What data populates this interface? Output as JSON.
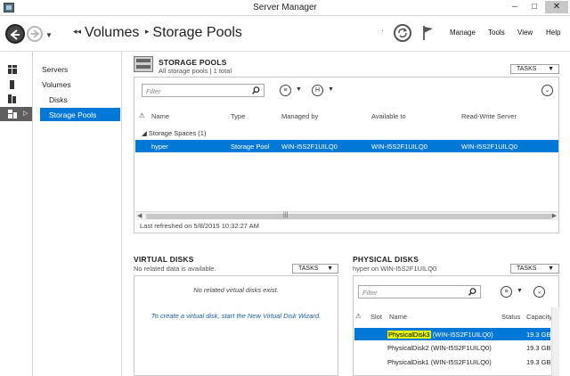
{
  "window": {
    "title": "Server Manager",
    "min": "–",
    "max": "□",
    "close": "✕"
  },
  "header": {
    "breadcrumb": [
      "Volumes",
      "Storage Pools"
    ],
    "menu": {
      "manage": "Manage",
      "tools": "Tools",
      "view": "View",
      "help": "Help"
    }
  },
  "nav": {
    "servers": "Servers",
    "volumes": "Volumes",
    "disks": "Disks",
    "storage_pools": "Storage Pools"
  },
  "storage_pools": {
    "title": "STORAGE POOLS",
    "subtitle": "All storage pools | 1 total",
    "tasks": "TASKS",
    "filter_placeholder": "Filter",
    "columns": {
      "name": "Name",
      "type": "Type",
      "managed_by": "Managed by",
      "available_to": "Available to",
      "rw_server": "Read-Write Server"
    },
    "group": "Storage Spaces (1)",
    "rows": [
      {
        "name": "hyper",
        "type": "Storage Pool",
        "managed_by": "WIN-I5S2F1UILQ0",
        "available_to": "WIN-I5S2F1UILQ0",
        "rw_server": "WIN-I5S2F1UILQ0"
      }
    ],
    "last_refreshed": "Last refreshed on 5/8/2015 10:32:27 AM"
  },
  "virtual_disks": {
    "title": "VIRTUAL DISKS",
    "subtitle": "No related data is available.",
    "tasks": "TASKS",
    "empty": "No related virtual disks exist.",
    "hint": "To create a virtual disk, start the New Virtual Disk Wizard."
  },
  "physical_disks": {
    "title": "PHYSICAL DISKS",
    "subtitle": "hyper on WIN-I5S2F1UILQ0",
    "tasks": "TASKS",
    "filter_placeholder": "Filter",
    "columns": {
      "slot": "Slot",
      "name": "Name",
      "status": "Status",
      "capacity": "Capacity"
    },
    "rows": [
      {
        "name_hl": "PhysicalDisk3",
        "name_rest": " (WIN-I5S2F1UILQ0)",
        "capacity": "19.3 GB"
      },
      {
        "name": "PhysicalDisk2 (WIN-I5S2F1UILQ0)",
        "capacity": "19.3 GB"
      },
      {
        "name": "PhysicalDisk1 (WIN-I5S2F1UILQ0)",
        "capacity": "19.3 GB"
      }
    ]
  },
  "colors": {
    "accent": "#0078d7",
    "highlight": "#e6f600",
    "rail_active": "#5f5f5f"
  }
}
